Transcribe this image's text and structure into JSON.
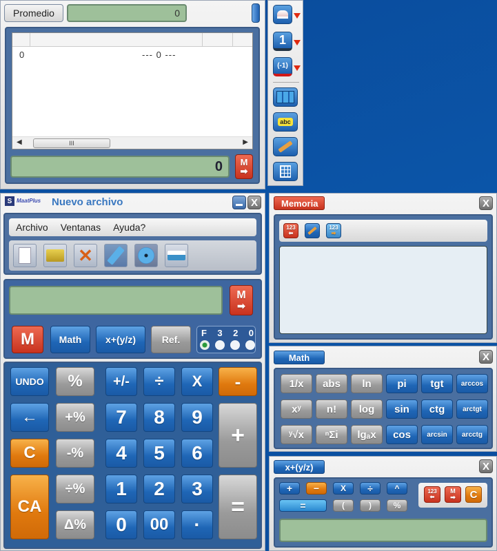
{
  "stats_window": {
    "mode_button": "Promedio",
    "mode_value": "0",
    "table": {
      "columns": [
        "",
        "",
        "",
        ""
      ],
      "rows": [
        {
          "index": "0",
          "value": "--- 0 ---"
        }
      ]
    },
    "scrollbar_thumb_label": "III",
    "display_value": "0",
    "memory_store_label": "M"
  },
  "side_toolbar": {
    "items": [
      {
        "name": "eraser",
        "label": ""
      },
      {
        "name": "decimals",
        "label": "1"
      },
      {
        "name": "negative",
        "label": "(-1)"
      },
      {
        "name": "table",
        "label": ""
      },
      {
        "name": "text",
        "label": "abc"
      },
      {
        "name": "notes",
        "label": ""
      },
      {
        "name": "grid",
        "label": ""
      }
    ]
  },
  "main_window": {
    "brand": "MaatPlus",
    "title": "Nuevo archivo",
    "menu": [
      "Archivo",
      "Ventanas",
      "Ayuda?"
    ],
    "toolbar": [
      "new",
      "open",
      "delete",
      "usb",
      "disc",
      "print"
    ],
    "display_value": "",
    "memory_store_label": "M",
    "mode_buttons": {
      "m": "M",
      "math": "Math",
      "frac": "x+(y/z)",
      "ref": "Ref."
    },
    "decimals": {
      "options": [
        "F",
        "3",
        "2",
        "0"
      ],
      "selected": "F"
    },
    "keys": {
      "undo": "UNDO",
      "pct": "%",
      "sign": "+/-",
      "div": "÷",
      "mul": "X",
      "minus": "-",
      "back": "←",
      "plus_pct": "+%",
      "seven": "7",
      "eight": "8",
      "nine": "9",
      "plus": "+",
      "clear": "C",
      "minus_pct": "-%",
      "four": "4",
      "five": "5",
      "six": "6",
      "ca": "CA",
      "div_pct": "÷%",
      "one": "1",
      "two": "2",
      "three": "3",
      "equals": "=",
      "delta_pct": "Δ%",
      "zero": "0",
      "double_zero": "00",
      "dot": "·"
    }
  },
  "memoria_window": {
    "title": "Memoria",
    "close": "X",
    "toolbar": [
      {
        "label": "123",
        "name": "recall"
      },
      {
        "label": "",
        "name": "edit"
      },
      {
        "label": "123",
        "name": "store"
      }
    ]
  },
  "math_window": {
    "title": "Math",
    "close": "X",
    "keys": [
      [
        "1/x",
        "abs",
        "ln",
        "pi",
        "tgt",
        "arccos"
      ],
      [
        "xʸ",
        "n!",
        "log",
        "sin",
        "ctg",
        "arctgt"
      ],
      [
        "ʸ√x",
        "ⁿΣi",
        "lgₐx",
        "cos",
        "arcsin",
        "arcctg"
      ]
    ]
  },
  "frac_window": {
    "title": "x+(y/z)",
    "close": "X",
    "ops_row1": [
      "+",
      "−",
      "X",
      "÷",
      "^"
    ],
    "ops_row2": [
      "=",
      "(",
      ")",
      "%"
    ],
    "actions": [
      "123",
      "M",
      "C"
    ],
    "display_value": ""
  }
}
